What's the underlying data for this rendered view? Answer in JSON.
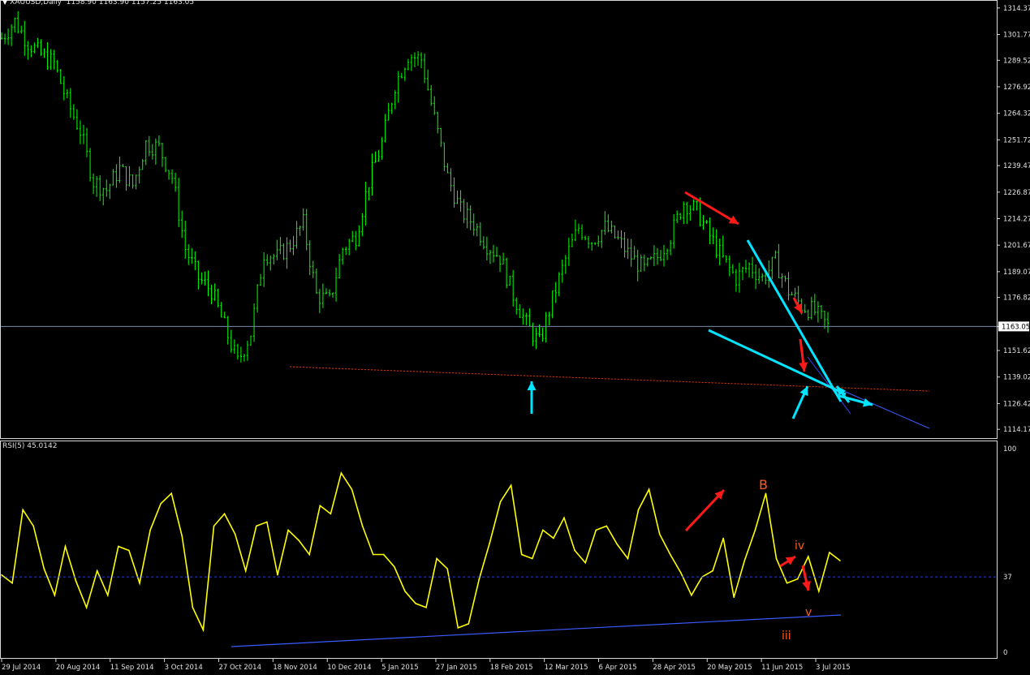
{
  "header": {
    "symbol": "XAUUSD,Daily",
    "ohlc": "1158.90 1163.90 1157.25 1163.05"
  },
  "rsi": {
    "label": "RSI(5) 45.0142",
    "levels": [
      "100",
      "37",
      "0"
    ],
    "level_value": 37
  },
  "annotations": {
    "wave_B": "B",
    "wave_iv": "iv",
    "wave_iii": "iii",
    "wave_v": "v"
  },
  "colors": {
    "background": "#000000",
    "candles": "#00ff00",
    "rsi_line": "#ffff00",
    "trendline": "#00e5ff",
    "arrow_red": "#ff1a1a",
    "label_orange": "#ff5a1a",
    "support_dotted": "#ff3300",
    "blue_line": "#3a5bff"
  },
  "chart_data": [
    {
      "type": "candlestick",
      "title": "XAUUSD,Daily",
      "price_ticks": [
        "1314.37",
        "1301.77",
        "1289.52",
        "1276.92",
        "1264.32",
        "1251.72",
        "1239.47",
        "1226.87",
        "1214.27",
        "1201.67",
        "1189.07",
        "1176.82",
        "1163.05",
        "1151.62",
        "1139.02",
        "1126.42",
        "1114.17"
      ],
      "current_price": 1163.05,
      "ylim": [
        1110,
        1317
      ],
      "date_ticks": [
        "29 Jul 2014",
        "20 Aug 2014",
        "11 Sep 2014",
        "3 Oct 2014",
        "27 Oct 2014",
        "18 Nov 2014",
        "10 Dec 2014",
        "5 Jan 2015",
        "27 Jan 2015",
        "18 Feb 2015",
        "12 Mar 2015",
        "6 Apr 2015",
        "28 Apr 2015",
        "20 May 2015",
        "11 Jun 2015",
        "3 Jul 2015"
      ],
      "close_path": [
        [
          0,
          1300
        ],
        [
          4,
          1308
        ],
        [
          8,
          1298
        ],
        [
          12,
          1292
        ],
        [
          16,
          1288
        ],
        [
          20,
          1270
        ],
        [
          24,
          1256
        ],
        [
          28,
          1232
        ],
        [
          32,
          1228
        ],
        [
          36,
          1238
        ],
        [
          40,
          1230
        ],
        [
          44,
          1250
        ],
        [
          48,
          1248
        ],
        [
          52,
          1234
        ],
        [
          56,
          1200
        ],
        [
          60,
          1186
        ],
        [
          64,
          1180
        ],
        [
          68,
          1163
        ],
        [
          72,
          1146
        ],
        [
          76,
          1160
        ],
        [
          80,
          1198
        ],
        [
          84,
          1196
        ],
        [
          88,
          1202
        ],
        [
          92,
          1212
        ],
        [
          96,
          1178
        ],
        [
          100,
          1175
        ],
        [
          104,
          1200
        ],
        [
          108,
          1206
        ],
        [
          112,
          1232
        ],
        [
          116,
          1250
        ],
        [
          120,
          1278
        ],
        [
          124,
          1292
        ],
        [
          128,
          1290
        ],
        [
          132,
          1262
        ],
        [
          136,
          1234
        ],
        [
          140,
          1218
        ],
        [
          144,
          1212
        ],
        [
          148,
          1202
        ],
        [
          152,
          1196
        ],
        [
          156,
          1178
        ],
        [
          160,
          1164
        ],
        [
          164,
          1155
        ],
        [
          168,
          1176
        ],
        [
          172,
          1195
        ],
        [
          176,
          1210
        ],
        [
          180,
          1204
        ],
        [
          184,
          1210
        ],
        [
          188,
          1204
        ],
        [
          192,
          1196
        ],
        [
          196,
          1190
        ],
        [
          200,
          1196
        ],
        [
          204,
          1206
        ],
        [
          208,
          1222
        ],
        [
          212,
          1218
        ],
        [
          216,
          1206
        ],
        [
          220,
          1195
        ],
        [
          224,
          1186
        ],
        [
          228,
          1192
        ],
        [
          232,
          1186
        ],
        [
          236,
          1194
        ],
        [
          240,
          1180
        ],
        [
          244,
          1173
        ],
        [
          248,
          1170
        ],
        [
          252,
          1163
        ]
      ]
    },
    {
      "type": "line",
      "title": "RSI(5) 45.0142",
      "ylim": [
        0,
        100
      ],
      "level": 37,
      "y_path": [
        [
          0,
          38
        ],
        [
          3,
          34
        ],
        [
          6,
          70
        ],
        [
          9,
          62
        ],
        [
          12,
          41
        ],
        [
          15,
          28
        ],
        [
          18,
          52
        ],
        [
          21,
          35
        ],
        [
          24,
          22
        ],
        [
          27,
          40
        ],
        [
          30,
          28
        ],
        [
          33,
          52
        ],
        [
          36,
          50
        ],
        [
          39,
          34
        ],
        [
          42,
          60
        ],
        [
          45,
          73
        ],
        [
          48,
          78
        ],
        [
          51,
          57
        ],
        [
          54,
          22
        ],
        [
          57,
          11
        ],
        [
          60,
          62
        ],
        [
          63,
          68
        ],
        [
          66,
          58
        ],
        [
          69,
          40
        ],
        [
          72,
          62
        ],
        [
          75,
          64
        ],
        [
          78,
          38
        ],
        [
          81,
          60
        ],
        [
          84,
          55
        ],
        [
          87,
          48
        ],
        [
          90,
          72
        ],
        [
          93,
          68
        ],
        [
          96,
          88
        ],
        [
          99,
          80
        ],
        [
          102,
          62
        ],
        [
          105,
          48
        ],
        [
          108,
          48
        ],
        [
          111,
          42
        ],
        [
          114,
          30
        ],
        [
          117,
          24
        ],
        [
          120,
          22
        ],
        [
          123,
          46
        ],
        [
          126,
          41
        ],
        [
          129,
          12
        ],
        [
          132,
          14
        ],
        [
          135,
          36
        ],
        [
          138,
          54
        ],
        [
          141,
          74
        ],
        [
          144,
          82
        ],
        [
          147,
          48
        ],
        [
          150,
          46
        ],
        [
          153,
          60
        ],
        [
          156,
          56
        ],
        [
          159,
          66
        ],
        [
          162,
          50
        ],
        [
          165,
          44
        ],
        [
          168,
          60
        ],
        [
          171,
          62
        ],
        [
          174,
          53
        ],
        [
          177,
          46
        ],
        [
          180,
          70
        ],
        [
          183,
          80
        ],
        [
          186,
          58
        ],
        [
          189,
          48
        ],
        [
          192,
          39
        ],
        [
          195,
          28
        ],
        [
          198,
          37
        ],
        [
          201,
          40
        ],
        [
          204,
          56
        ],
        [
          207,
          27
        ],
        [
          210,
          45
        ],
        [
          213,
          60
        ],
        [
          216,
          78
        ],
        [
          219,
          46
        ],
        [
          222,
          34
        ],
        [
          225,
          36
        ],
        [
          228,
          47
        ],
        [
          231,
          30
        ],
        [
          234,
          49
        ],
        [
          237,
          45
        ]
      ],
      "support_line": "lows trendline"
    }
  ]
}
